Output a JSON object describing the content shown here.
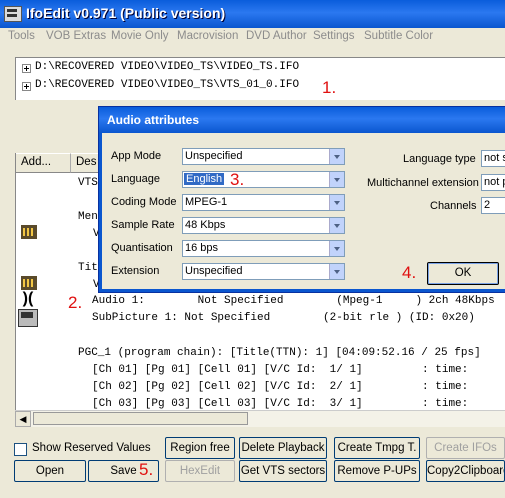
{
  "app": {
    "title": "IfoEdit v0.971 (Public version)"
  },
  "menu": [
    "Tools",
    "VOB Extras",
    "Movie Only",
    "Macrovision",
    "DVD Author",
    "Settings",
    "Subtitle Color"
  ],
  "tree": {
    "items": [
      "D:\\RECOVERED VIDEO\\VIDEO_TS\\VIDEO_TS.IFO",
      "D:\\RECOVERED VIDEO\\VIDEO_TS\\VTS_01_0.IFO"
    ],
    "marker": "1."
  },
  "list": {
    "headers": [
      "Add...",
      "Des"
    ],
    "lines": {
      "vts": "VTS",
      "menu": "Men",
      "menu_sub": "V",
      "title": "Tit",
      "title_sub": "V",
      "audio": "Audio 1:        Not Specified        (Mpeg-1     ) 2ch 48Kbps",
      "subpicture": "SubPicture 1: Not Specified        (2-bit rle ) (ID: 0x20)",
      "pgc": "PGC_1 (program chain): [Title(TTN): 1] [04:09:52.16 / 25 fps]",
      "ch1": "[Ch 01] [Pg 01] [Cell 01] [V/C Id:  1/ 1]         : time:",
      "ch2": "[Ch 02] [Pg 02] [Cell 02] [V/C Id:  2/ 1]         : time:",
      "ch3": "[Ch 03] [Pg 03] [Cell 03] [V/C Id:  3/ 1]         : time:"
    },
    "marker": "2."
  },
  "dialog": {
    "title": "Audio attributes",
    "fields": [
      {
        "label": "App Mode",
        "value": "Unspecified"
      },
      {
        "label": "Language",
        "value": "English"
      },
      {
        "label": "Coding Mode",
        "value": "MPEG-1"
      },
      {
        "label": "Sample Rate",
        "value": "48 Kbps"
      },
      {
        "label": "Quantisation",
        "value": "16 bps"
      },
      {
        "label": "Extension",
        "value": "Unspecified"
      }
    ],
    "right_fields": [
      {
        "label": "Language type",
        "value": "not s"
      },
      {
        "label": "Multichannel extension",
        "value": "not p"
      },
      {
        "label": "Channels",
        "value": "2"
      }
    ],
    "ok_label": "OK",
    "marker_language": "3.",
    "marker_ok": "4."
  },
  "buttons": {
    "show_reserved": "Show Reserved Values",
    "region_free": "Region free",
    "delete_playback": "Delete Playback",
    "create_tmpg": "Create Tmpg T.",
    "create_ifos": "Create IFOs",
    "open": "Open",
    "save": "Save",
    "hexedit": "HexEdit",
    "get_vts": "Get VTS sectors",
    "remove_pups": "Remove P-UPs",
    "copy_clipboard": "Copy2Clipboard"
  },
  "marker_save": "5."
}
